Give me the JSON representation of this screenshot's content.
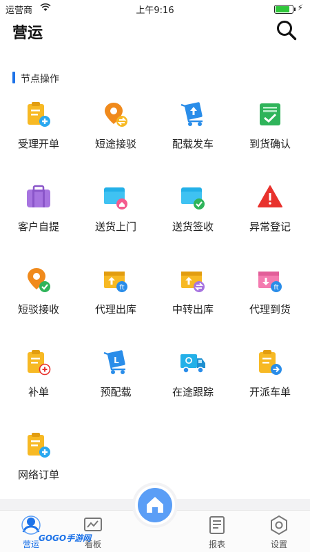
{
  "status_bar": {
    "carrier": "运营商",
    "time": "上午9:16",
    "battery_level": 0.85
  },
  "header": {
    "title": "营运",
    "search_icon": "search-icon"
  },
  "section": {
    "title": "节点操作",
    "accent_color": "#1e73e8"
  },
  "grid_items": [
    {
      "label": "受理开单",
      "icon": "clipboard-add-icon"
    },
    {
      "label": "短途接驳",
      "icon": "location-swap-icon"
    },
    {
      "label": "配载发车",
      "icon": "cart-load-icon"
    },
    {
      "label": "到货确认",
      "icon": "list-check-icon"
    },
    {
      "label": "客户自提",
      "icon": "suitcase-icon"
    },
    {
      "label": "送货上门",
      "icon": "folder-home-icon"
    },
    {
      "label": "送货签收",
      "icon": "folder-check-icon"
    },
    {
      "label": "异常登记",
      "icon": "warning-icon"
    },
    {
      "label": "短驳接收",
      "icon": "location-check-icon"
    },
    {
      "label": "代理出库",
      "icon": "box-out-icon"
    },
    {
      "label": "中转出库",
      "icon": "box-transfer-icon"
    },
    {
      "label": "代理到货",
      "icon": "box-in-icon"
    },
    {
      "label": "补单",
      "icon": "clipboard-plus-icon"
    },
    {
      "label": "预配载",
      "icon": "cart-preload-icon"
    },
    {
      "label": "在途跟踪",
      "icon": "truck-icon"
    },
    {
      "label": "开派车单",
      "icon": "clipboard-arrow-icon"
    },
    {
      "label": "网络订单",
      "icon": "clipboard-add-icon"
    }
  ],
  "tab_bar": {
    "tabs": [
      {
        "label": "营运",
        "icon": "operations-icon",
        "active": true
      },
      {
        "label": "看板",
        "icon": "board-icon",
        "active": false
      },
      {
        "label": "报表",
        "icon": "report-icon",
        "active": false
      },
      {
        "label": "设置",
        "icon": "settings-icon",
        "active": false
      }
    ],
    "home_icon": "home-icon"
  },
  "watermark": "GOGO手游网"
}
